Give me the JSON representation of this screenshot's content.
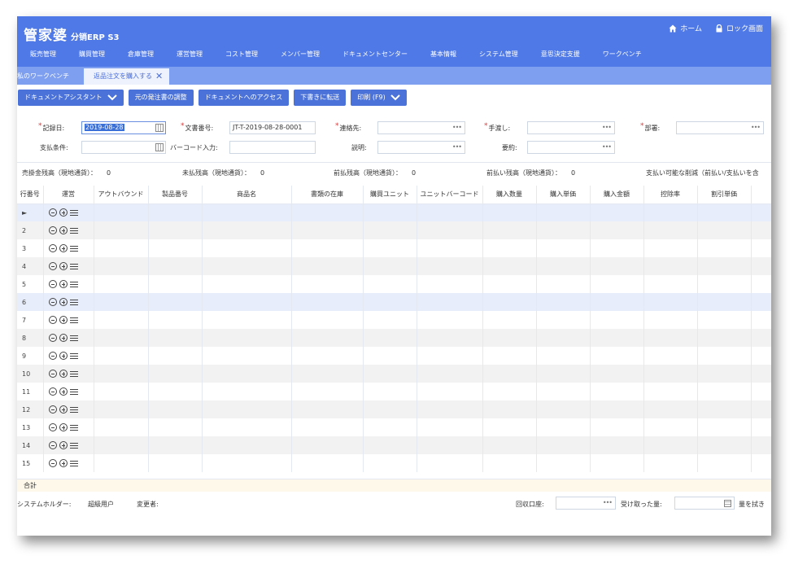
{
  "app": {
    "logo_main": "管家婆",
    "logo_sub": "分销ERP S3",
    "header_links": [
      {
        "label": "ホーム",
        "icon": "home-icon"
      },
      {
        "label": "ロック画面",
        "icon": "lock-icon"
      }
    ],
    "menu": [
      "販売管理",
      "購買管理",
      "倉庫管理",
      "運営管理",
      "コスト管理",
      "メンバー管理",
      "ドキュメントセンター",
      "基本情報",
      "システム管理",
      "意思決定支援",
      "ワークベンチ"
    ]
  },
  "tabs": {
    "inactive": "私のワークベンチ",
    "active": "返品注文を購入する",
    "close_symbol": "✕"
  },
  "toolbar": {
    "doc_assistant": "ドキュメントアシスタント",
    "adjust": "元の発注書の調整",
    "access": "ドキュメントへのアクセス",
    "transfer": "下書きに転送",
    "print": "印刷 (F9)"
  },
  "form": {
    "record_date_label": "記録日:",
    "record_date_value": "2019-08-28",
    "doc_no_label": "文書番号:",
    "doc_no_value": "JT-T-2019-08-28-0001",
    "contact_label": "連絡先:",
    "handover_label": "手渡し:",
    "dept_label": "部署:",
    "payment_label": "支払条件:",
    "barcode_label": "バーコード入力:",
    "desc_label": "説明:",
    "summary_label": "要約:",
    "dots": "•••"
  },
  "balances": [
    {
      "label": "売掛金残高（現地通貨）：",
      "value": "0"
    },
    {
      "label": "未払残高（現地通貨）：",
      "value": "0"
    },
    {
      "label": "前払残高（現地通貨）：",
      "value": "0"
    },
    {
      "label": "前払い残高（現地通貨）：",
      "value": "0"
    },
    {
      "label": "支払い可能な削減（前払い/支払いを含",
      "value": ""
    }
  ],
  "grid": {
    "columns": [
      "行番号",
      "運営",
      "アウトバウンド",
      "製品番号",
      "商品名",
      "書類の在庫",
      "購買ユニット",
      "ユニットバーコード",
      "購入数量",
      "購入単価",
      "購入金額",
      "控除率",
      "割引単価",
      "割"
    ],
    "rows": [
      "►",
      "2",
      "3",
      "4",
      "5",
      "6",
      "7",
      "8",
      "9",
      "10",
      "11",
      "12",
      "13",
      "14",
      "15"
    ],
    "total_label": "合計"
  },
  "footer": {
    "holder_label": "システムホルダー:",
    "holder_value": "超級用户",
    "changer_label": "変更者:",
    "recovery_label": "回収口座:",
    "received_label": "受け取った量:",
    "discount_label": "量を拭き"
  },
  "colors": {
    "header": "#4f79e6",
    "tabbar": "#7e9ff0",
    "button": "#4a72d9",
    "required": "#e03b3b"
  }
}
